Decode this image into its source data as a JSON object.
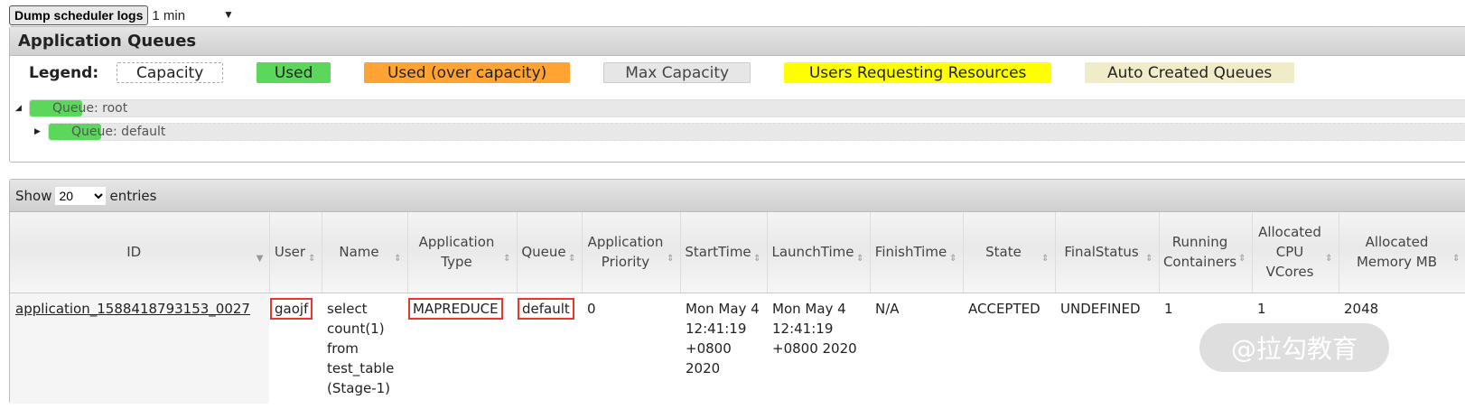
{
  "toolbar": {
    "dump_label": "Dump scheduler logs",
    "interval": "1 min"
  },
  "queues_panel": {
    "title": "Application Queues",
    "legend_label": "Legend:",
    "legend": [
      {
        "label": "Capacity",
        "color": "#ffffff"
      },
      {
        "label": "Used",
        "color": "#5bd75b"
      },
      {
        "label": "Used (over capacity)",
        "color": "#ffa333"
      },
      {
        "label": "Max Capacity",
        "color": "#e6e6e6"
      },
      {
        "label": "Users Requesting Resources",
        "color": "#ffff00"
      },
      {
        "label": "Auto Created Queues",
        "color": "#f0ecc8"
      }
    ],
    "queues": [
      {
        "label": "Queue: root"
      },
      {
        "label": "Queue: default"
      }
    ]
  },
  "table": {
    "show": "Show",
    "page_size": "20",
    "entries": "entries",
    "columns": [
      "ID",
      "User",
      "Name",
      "Application Type",
      "Queue",
      "Application Priority",
      "StartTime",
      "LaunchTime",
      "FinishTime",
      "State",
      "FinalStatus",
      "Running Containers",
      "Allocated CPU VCores",
      "Allocated Memory MB"
    ],
    "rows": [
      {
        "id": "application_1588418793153_0027",
        "user": "gaojf",
        "name": "select count(1) from test_table (Stage-1)",
        "type": "MAPREDUCE",
        "queue": "default",
        "priority": "0",
        "start": "Mon May 4 12:41:19 +0800 2020",
        "launch": "Mon May 4 12:41:19 +0800 2020",
        "finish": "N/A",
        "state": "ACCEPTED",
        "final": "UNDEFINED",
        "containers": "1",
        "vcores": "1",
        "memory": "2048"
      }
    ]
  },
  "watermark": "@拉勾教育"
}
